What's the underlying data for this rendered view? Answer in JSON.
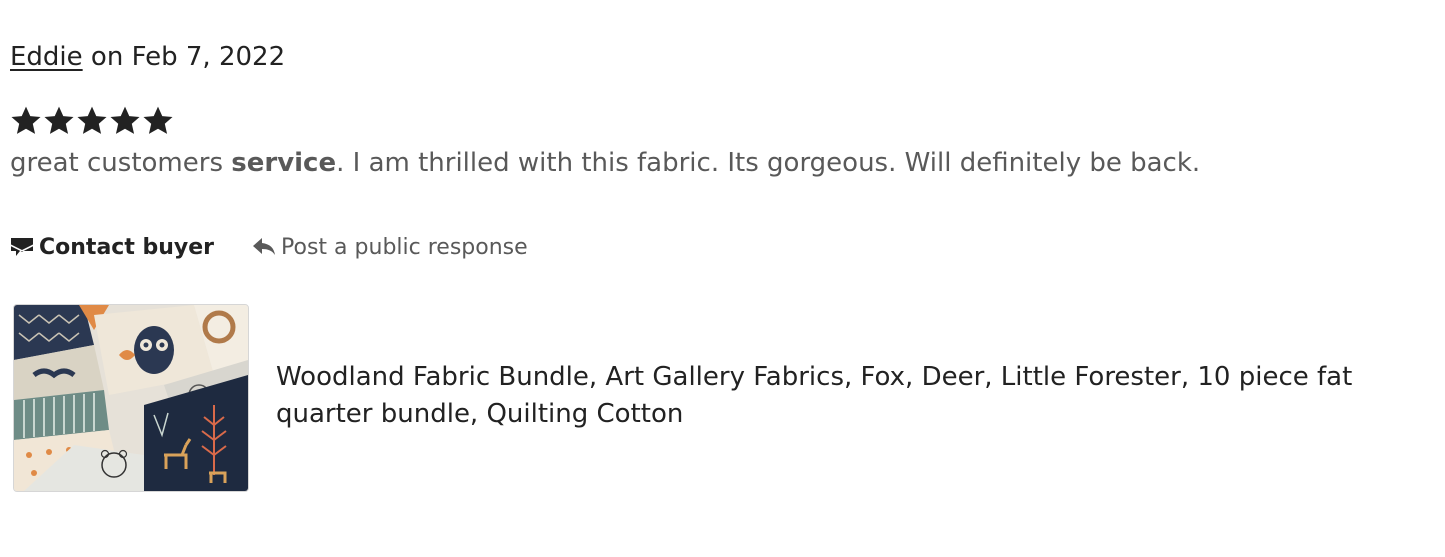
{
  "review": {
    "author": "Eddie",
    "date_text": " on Feb 7, 2022",
    "rating": 5,
    "rating_max": 5,
    "text_before": "great customers ",
    "text_bold": "service",
    "text_after": ". I am thrilled with this fabric. Its gorgeous. Will definitely be back."
  },
  "actions": {
    "contact_label": "Contact buyer",
    "contact_icon": "envelope-flag-icon",
    "respond_label": "Post a public response",
    "respond_icon": "reply-arrow-icon"
  },
  "listing": {
    "title": "Woodland Fabric Bundle, Art Gallery Fabrics, Fox, Deer, Little Forester, 10 piece fat quarter bundle, Quilting Cotton",
    "image_alt": "woodland-fabric-bundle-thumbnail"
  },
  "colors": {
    "text_primary": "#222222",
    "text_secondary": "#595959",
    "star": "#222222"
  }
}
